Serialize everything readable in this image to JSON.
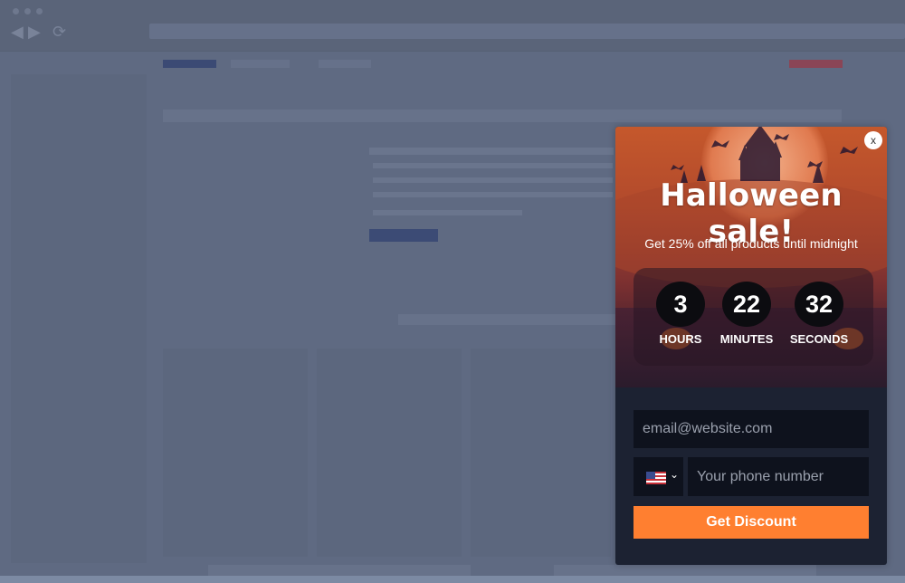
{
  "popup": {
    "close_label": "x",
    "title": "Halloween sale!",
    "subtitle": "Get 25% off all products until midnight",
    "countdown": [
      {
        "value": "3",
        "label": "HOURS"
      },
      {
        "value": "22",
        "label": "MINUTES"
      },
      {
        "value": "32",
        "label": "SECONDS"
      }
    ],
    "email_placeholder": "email@website.com",
    "country_flag": "us-flag-icon",
    "phone_placeholder": "Your phone number",
    "cta_label": "Get Discount"
  },
  "colors": {
    "cta": "#ff7f30",
    "popup_bg": "#1c2232",
    "field_bg": "#0e121d",
    "overlay": "#5f6a82"
  }
}
